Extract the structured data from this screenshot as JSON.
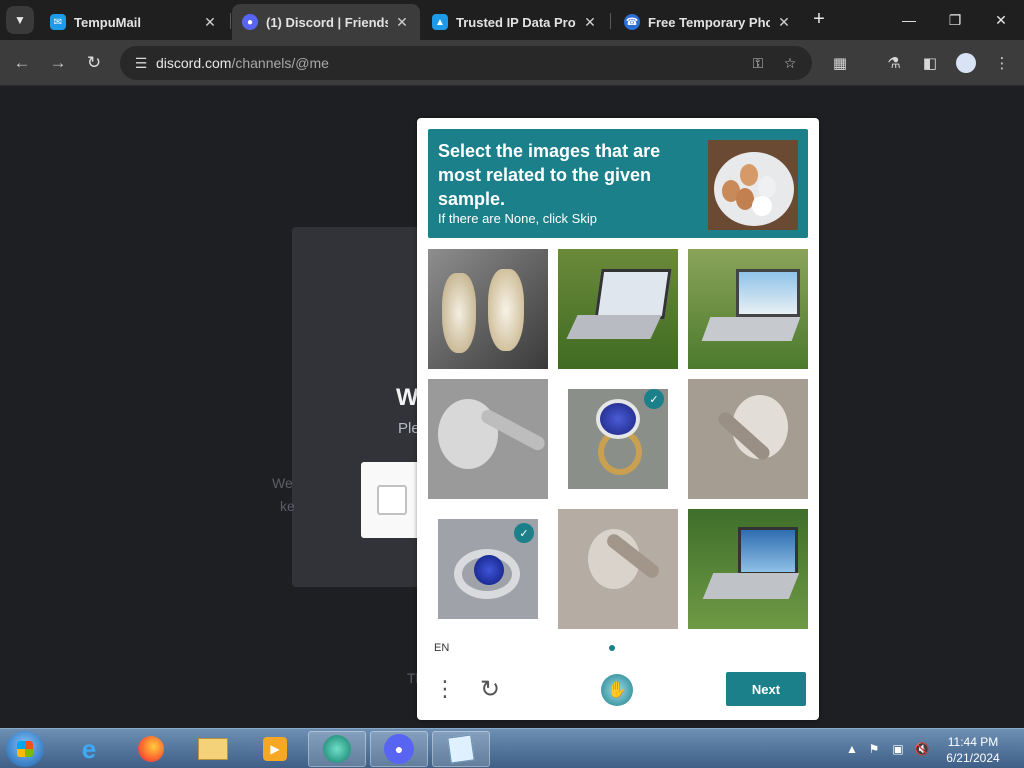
{
  "browser": {
    "tabs": [
      {
        "title": "TempuMail",
        "active": false,
        "favicon_color": "#1e9be8"
      },
      {
        "title": "(1) Discord | Friends",
        "active": true,
        "favicon_color": "#5865f2"
      },
      {
        "title": "Trusted IP Data Provid",
        "active": false,
        "favicon_color": "#1e9be8"
      },
      {
        "title": "Free Temporary Phone",
        "active": false,
        "favicon_color": "#2b6fd6"
      }
    ],
    "url_host": "discord.com",
    "url_path": "/channels/@me"
  },
  "page": {
    "heading_partial": "W",
    "subtext_partial": "Ple",
    "faint_left_1": "We",
    "faint_left_2": "ke",
    "faint_bottom": "Th"
  },
  "captcha": {
    "prompt_title": "Select the images that are most related to the given sample.",
    "prompt_subtitle": "If there are None, click Skip",
    "sample_image": "plate-with-eggs",
    "tiles": [
      {
        "subject": "earrings",
        "selected": false
      },
      {
        "subject": "laptop-on-grass",
        "selected": false
      },
      {
        "subject": "laptop-on-grass",
        "selected": false
      },
      {
        "subject": "pelican",
        "selected": false
      },
      {
        "subject": "sapphire-ring",
        "selected": true
      },
      {
        "subject": "pelican",
        "selected": false
      },
      {
        "subject": "sapphire-ring",
        "selected": true
      },
      {
        "subject": "pelican",
        "selected": false
      },
      {
        "subject": "laptop-on-grass",
        "selected": false
      }
    ],
    "language": "EN",
    "next_label": "Next",
    "accent_color": "#1b8089"
  },
  "taskbar": {
    "time": "11:44 PM",
    "date": "6/21/2024"
  }
}
